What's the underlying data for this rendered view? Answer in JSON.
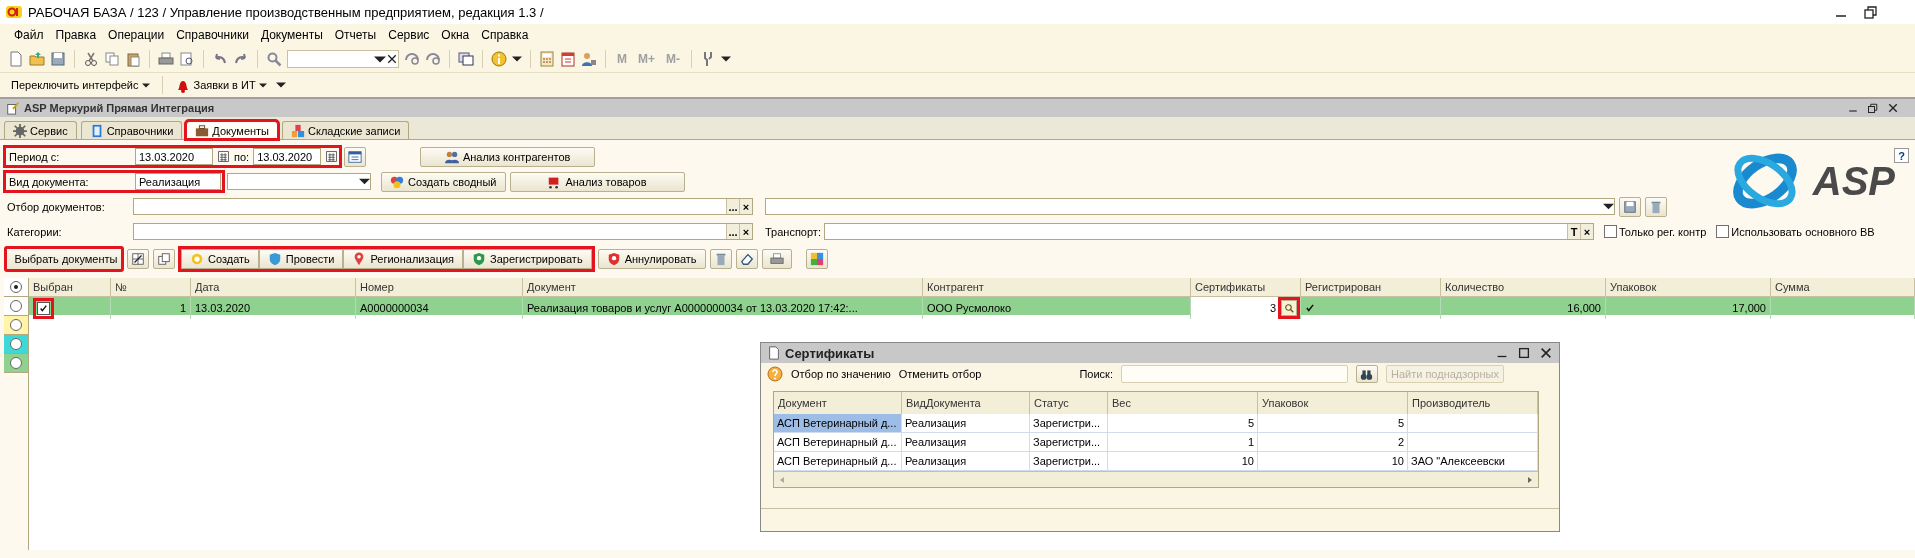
{
  "app_window": {
    "title": "РАБОЧАЯ БАЗА / 123 /  Управление производственным предприятием, редакция 1.3 /"
  },
  "menu": [
    {
      "label": "Файл"
    },
    {
      "label": "Правка"
    },
    {
      "label": "Операции"
    },
    {
      "label": "Справочники"
    },
    {
      "label": "Документы"
    },
    {
      "label": "Отчеты"
    },
    {
      "label": "Сервис"
    },
    {
      "label": "Окна"
    },
    {
      "label": "Справка"
    }
  ],
  "toolbar": {
    "memory_buttons": [
      "M",
      "M+",
      "M-"
    ]
  },
  "quick_bar": [
    {
      "label": "Переключить интерфейс"
    },
    {
      "label": "Заявки в ИТ"
    }
  ],
  "form": {
    "title": "ASP Меркурий Прямая Интеграция",
    "tabs": [
      {
        "label": "Сервис",
        "selected": false,
        "highlighted": false
      },
      {
        "label": "Справочники",
        "selected": false,
        "highlighted": false
      },
      {
        "label": "Документы",
        "selected": true,
        "highlighted": true
      },
      {
        "label": "Складские записи",
        "selected": false,
        "highlighted": false
      }
    ],
    "period": {
      "label": "Период с:",
      "from": "13.03.2020",
      "to_label": "по:",
      "to": "13.03.2020",
      "highlighted": true
    },
    "doc_type": {
      "label": "Вид документа:",
      "value": "Реализация",
      "highlighted": true
    },
    "side_buttons": [
      {
        "label": "Анализ контрагентов"
      },
      {
        "label": "Создать сводный"
      },
      {
        "label": "Анализ товаров"
      }
    ],
    "filter": {
      "label": "Отбор документов:",
      "buttons": [
        "...",
        "×"
      ]
    },
    "categories": {
      "label": "Категории:",
      "buttons": [
        "...",
        "×"
      ]
    },
    "transport": {
      "label": "Транспорт:",
      "buttons": [
        "T",
        "×"
      ]
    },
    "help_button": "?",
    "checkboxes": [
      {
        "label": "Только рег. контр",
        "checked": false
      },
      {
        "label": "Использовать основного ВВ",
        "checked": false
      }
    ],
    "logo_text": "ASP",
    "select_button": {
      "label": "Выбрать документы",
      "highlighted": true
    },
    "workflow_group": {
      "highlighted": true,
      "buttons": [
        {
          "label": "Создать"
        },
        {
          "label": "Провести"
        },
        {
          "label": "Регионализация"
        },
        {
          "label": "Зарегистрировать"
        }
      ]
    },
    "cancel_button": {
      "label": "Аннулировать"
    },
    "color_filters": [
      {
        "selected": true,
        "color": "#ffffff"
      },
      {
        "selected": false,
        "color": "#ffffff"
      },
      {
        "selected": false,
        "color": "#fff4a8"
      },
      {
        "selected": false,
        "color": "#3fd8d8"
      },
      {
        "selected": false,
        "color": "#8fd18f"
      }
    ],
    "table": {
      "columns": [
        "Выбран",
        "№",
        "Дата",
        "Номер",
        "Документ",
        "Контрагент",
        "Сертификаты",
        "Регистрирован",
        "Количество",
        "Упаковок",
        "Сумма"
      ],
      "rows": [
        {
          "selected": true,
          "checked": true,
          "checkbox_highlighted": true,
          "number": "1",
          "date": "13.03.2020",
          "doc_number": "А0000000034",
          "document": "Реализация товаров и услуг А0000000034 от 13.03.2020 17:42:...",
          "counterparty": "ООО Русмолоко",
          "certificates": "3",
          "certificates_button_highlighted": true,
          "registered": true,
          "quantity": "16,000",
          "packages": "17,000"
        }
      ]
    }
  },
  "certificates_dialog": {
    "title": "Сертификаты",
    "actions": [
      {
        "label": "Отбор по значению"
      },
      {
        "label": "Отменить отбор"
      }
    ],
    "search_label": "Поиск:",
    "find_button": {
      "label": "Найти поднадзорных",
      "disabled": true
    },
    "columns": [
      "Документ",
      "ВидДокумента",
      "Статус",
      "Вес",
      "Упаковок",
      "Производитель"
    ],
    "rows": [
      {
        "selected": true,
        "document": "АСП Ветеринарный д...",
        "doc_type": "Реализация",
        "status": "Зарегистри...",
        "weight": "5",
        "packages": "5"
      },
      {
        "selected": false,
        "document": "АСП Ветеринарный д...",
        "doc_type": "Реализация",
        "status": "Зарегистри...",
        "weight": "1",
        "packages": "2"
      },
      {
        "selected": false,
        "document": "АСП Ветеринарный д...",
        "doc_type": "Реализация",
        "status": "Зарегистри...",
        "weight": "10",
        "packages": "10",
        "producer": "ЗАО \"Алексеевски"
      }
    ]
  }
}
